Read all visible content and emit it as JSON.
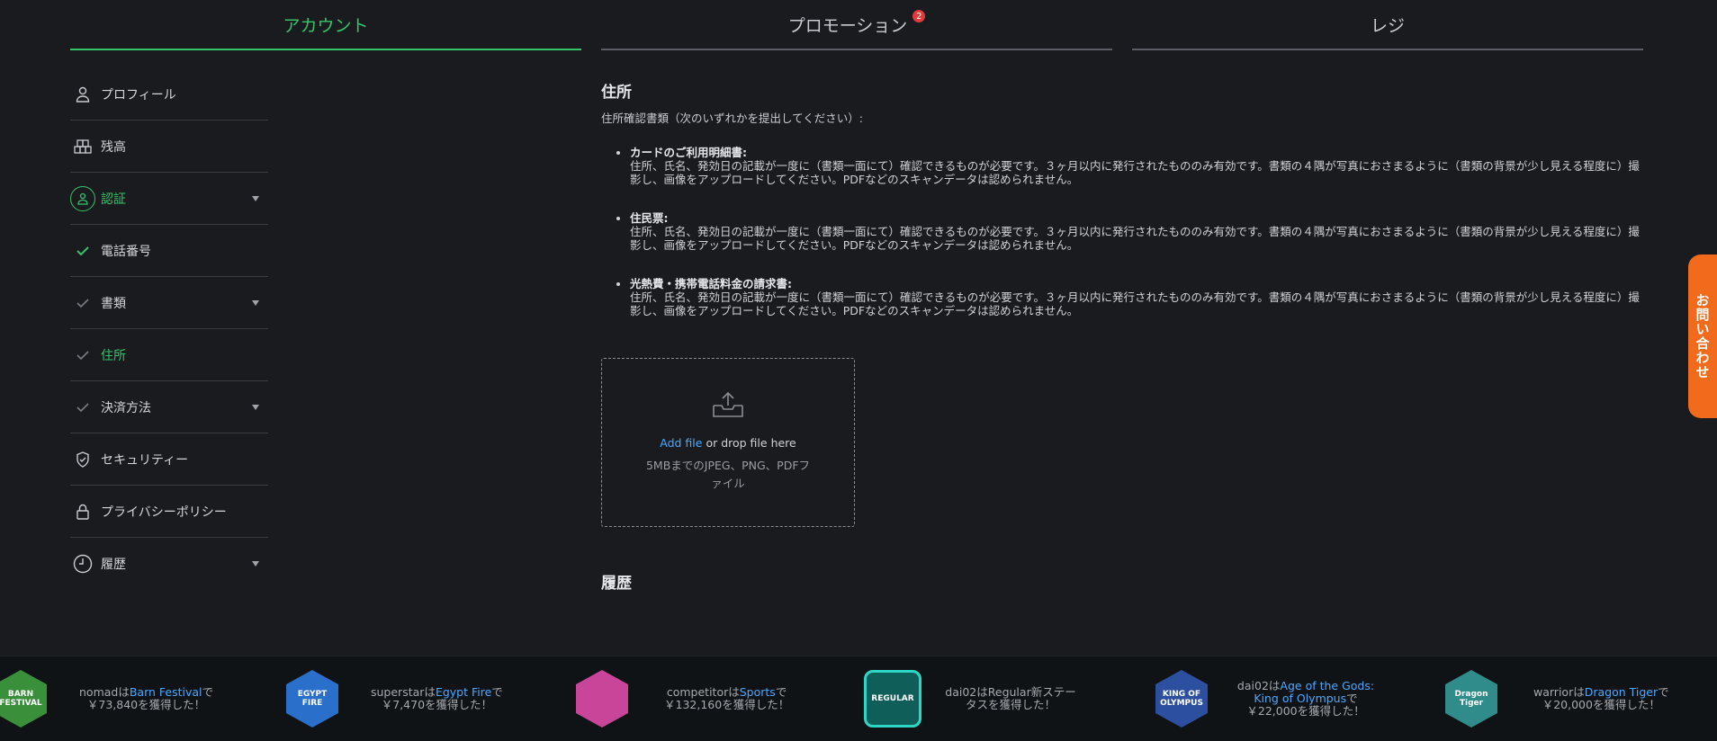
{
  "tabs": [
    {
      "label": "アカウント",
      "active": true
    },
    {
      "label": "プロモーション",
      "badge": "2"
    },
    {
      "label": "レジ"
    }
  ],
  "sidebar": {
    "items": [
      {
        "label": "プロフィール",
        "icon": "user-icon"
      },
      {
        "label": "残高",
        "icon": "coins-icon"
      },
      {
        "label": "認証",
        "icon": "verification-icon",
        "active": true,
        "expandable": true
      },
      {
        "label": "電話番号",
        "icon": "check-icon",
        "status": "verified"
      },
      {
        "label": "書類",
        "icon": "check-icon",
        "expandable": true
      },
      {
        "label": "住所",
        "icon": "check-icon",
        "active": true
      },
      {
        "label": "決済方法",
        "icon": "check-icon",
        "expandable": true
      },
      {
        "label": "セキュリティー",
        "icon": "shield-icon"
      },
      {
        "label": "プライバシーポリシー",
        "icon": "lock-icon"
      },
      {
        "label": "履歴",
        "icon": "clock-icon",
        "expandable": true
      }
    ]
  },
  "main": {
    "title": "住所",
    "intro": "住所確認書類（次のいずれかを提出してください）:",
    "documents": [
      {
        "title": "カードのご利用明細書:",
        "text": "住所、氏名、発効日の記載が一度に（書類一面にて）確認できるものが必要です。３ヶ月以内に発行されたもののみ有効です。書類の４隅が写真におさまるように（書類の背景が少し見える程度に）撮影し、画像をアップロードしてください。PDFなどのスキャンデータは認められません。"
      },
      {
        "title": "住民票:",
        "text": "住所、氏名、発効日の記載が一度に（書類一面にて）確認できるものが必要です。３ヶ月以内に発行されたもののみ有効です。書類の４隅が写真におさまるように（書類の背景が少し見える程度に）撮影し、画像をアップロードしてください。PDFなどのスキャンデータは認められません。"
      },
      {
        "title": "光熱費・携帯電話料金の請求書:",
        "text": "住所、氏名、発効日の記載が一度に（書類一面にて）確認できるものが必要です。３ヶ月以内に発行されたもののみ有効です。書類の４隅が写真におさまるように（書類の背景が少し見える程度に）撮影し、画像をアップロードしてください。PDFなどのスキャンデータは認められません。"
      }
    ],
    "upload": {
      "add_file": "Add file",
      "drop_text": " or drop file here",
      "hint": "5MBまでのJPEG、PNG、PDFファイル"
    },
    "history_title": "履歴"
  },
  "contact_label": "お問い合わせ",
  "ticker": [
    {
      "user": "nomad",
      "pre": "は",
      "game": "Barn Festival",
      "post": "で",
      "amount": "￥73,840を獲得した！",
      "thumb_label": "BARN FESTIVAL",
      "color": "#3a8f3a"
    },
    {
      "user": "superstar",
      "pre": "は",
      "game": "Egypt Fire",
      "post": "で",
      "amount": "￥7,470を獲得した！",
      "thumb_label": "EGYPT FIRE",
      "color": "#2a6fc9"
    },
    {
      "user": "competitor",
      "pre": "は",
      "game": "Sports",
      "post": "で",
      "amount": "￥132,160を獲得した！",
      "thumb_label": "",
      "color": "#c9459a"
    },
    {
      "user": "dai02",
      "pre": "は",
      "game": "",
      "post": "Regular新ステータスを獲得した！",
      "amount": "",
      "thumb_label": "REGULAR",
      "color": "#0f5e5a"
    },
    {
      "user": "dai02",
      "pre": "は",
      "game": "Age of the Gods: King of Olympus",
      "post": "で",
      "amount": "￥22,000を獲得した！",
      "thumb_label": "KING OF OLYMPUS",
      "color": "#2d4fa0"
    },
    {
      "user": "warrior",
      "pre": "は",
      "game": "Dragon Tiger",
      "post": "で",
      "amount": "￥20,000を獲得した！",
      "thumb_label": "Dragon Tiger",
      "color": "#2f8c8a"
    }
  ]
}
